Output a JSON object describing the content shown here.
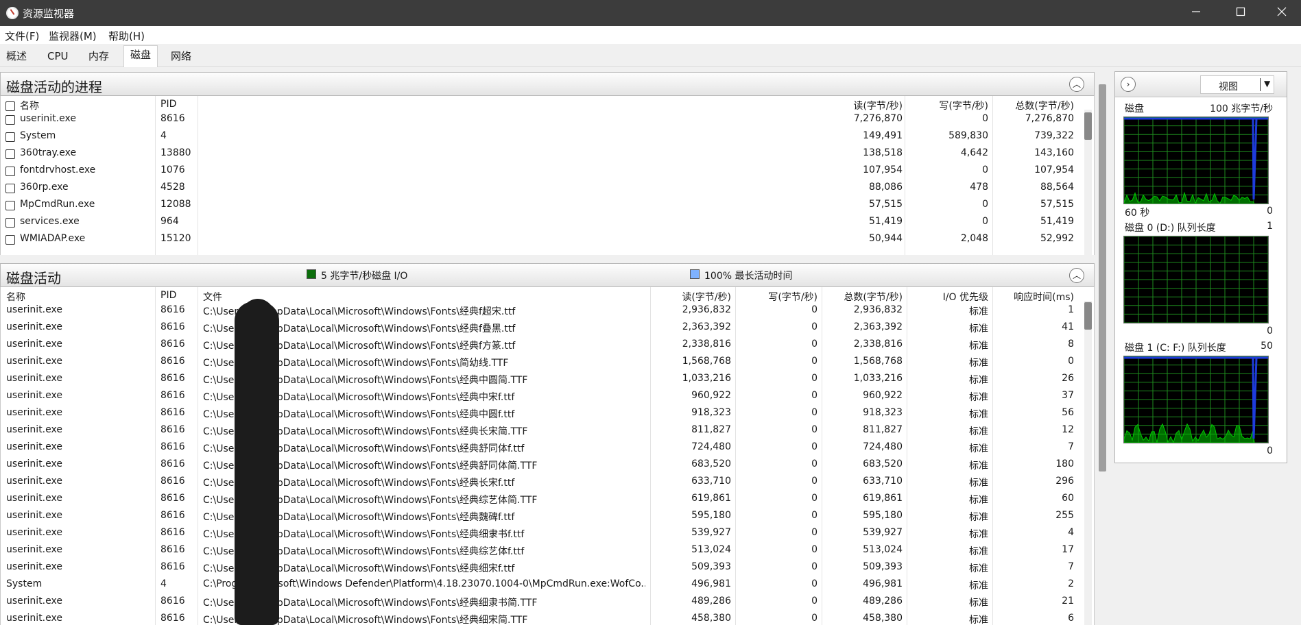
{
  "window": {
    "title": "资源监视器",
    "min_icon": "minimize-icon",
    "max_icon": "maximize-icon",
    "close_icon": "close-icon"
  },
  "menu": [
    "文件(F)",
    "监视器(M)",
    "帮助(H)"
  ],
  "tabs": [
    "概述",
    "CPU",
    "内存",
    "磁盘",
    "网络"
  ],
  "active_tab": "磁盘",
  "processes_panel": {
    "title": "磁盘活动的进程",
    "columns": [
      "名称",
      "PID",
      "读(字节/秒)",
      "写(字节/秒)",
      "总数(字节/秒)"
    ],
    "rows": [
      {
        "name": "userinit.exe",
        "pid": "8616",
        "read": "7,276,870",
        "write": "0",
        "total": "7,276,870"
      },
      {
        "name": "System",
        "pid": "4",
        "read": "149,491",
        "write": "589,830",
        "total": "739,322"
      },
      {
        "name": "360tray.exe",
        "pid": "13880",
        "read": "138,518",
        "write": "4,642",
        "total": "143,160"
      },
      {
        "name": "fontdrvhost.exe",
        "pid": "1076",
        "read": "107,954",
        "write": "0",
        "total": "107,954"
      },
      {
        "name": "360rp.exe",
        "pid": "4528",
        "read": "88,086",
        "write": "478",
        "total": "88,564"
      },
      {
        "name": "MpCmdRun.exe",
        "pid": "12088",
        "read": "57,515",
        "write": "0",
        "total": "57,515"
      },
      {
        "name": "services.exe",
        "pid": "964",
        "read": "51,419",
        "write": "0",
        "total": "51,419"
      },
      {
        "name": "WMIADAP.exe",
        "pid": "15120",
        "read": "50,944",
        "write": "2,048",
        "total": "52,992"
      }
    ]
  },
  "disk_panel": {
    "title": "磁盘活动",
    "legend_io": "5 兆字节/秒磁盘 I/O",
    "legend_active": "100% 最长活动时间",
    "legend_io_color": "#0b6e0b",
    "legend_active_color": "#7fb2ff",
    "columns": [
      "名称",
      "PID",
      "文件",
      "读(字节/秒)",
      "写(字节/秒)",
      "总数(字节/秒)",
      "I/O 优先级",
      "响应时间(ms)"
    ],
    "rows": [
      {
        "name": "userinit.exe",
        "pid": "8616",
        "file": "C:\\Users\\██\\AppData\\Local\\Microsoft\\Windows\\Fonts\\经典f超宋.ttf",
        "read": "2,936,832",
        "write": "0",
        "total": "2,936,832",
        "prio": "标准",
        "resp": "1"
      },
      {
        "name": "userinit.exe",
        "pid": "8616",
        "file": "C:\\Users\\██\\AppData\\Local\\Microsoft\\Windows\\Fonts\\经典f叠黑.ttf",
        "read": "2,363,392",
        "write": "0",
        "total": "2,363,392",
        "prio": "标准",
        "resp": "41"
      },
      {
        "name": "userinit.exe",
        "pid": "8616",
        "file": "C:\\Users\\██\\AppData\\Local\\Microsoft\\Windows\\Fonts\\经典f方篆.ttf",
        "read": "2,338,816",
        "write": "0",
        "total": "2,338,816",
        "prio": "标准",
        "resp": "8"
      },
      {
        "name": "userinit.exe",
        "pid": "8616",
        "file": "C:\\Users\\██\\AppData\\Local\\Microsoft\\Windows\\Fonts\\简幼线.TTF",
        "read": "1,568,768",
        "write": "0",
        "total": "1,568,768",
        "prio": "标准",
        "resp": "0"
      },
      {
        "name": "userinit.exe",
        "pid": "8616",
        "file": "C:\\Users\\██\\AppData\\Local\\Microsoft\\Windows\\Fonts\\经典中圆简.TTF",
        "read": "1,033,216",
        "write": "0",
        "total": "1,033,216",
        "prio": "标准",
        "resp": "26"
      },
      {
        "name": "userinit.exe",
        "pid": "8616",
        "file": "C:\\Users\\██\\AppData\\Local\\Microsoft\\Windows\\Fonts\\经典中宋f.ttf",
        "read": "960,922",
        "write": "0",
        "total": "960,922",
        "prio": "标准",
        "resp": "37"
      },
      {
        "name": "userinit.exe",
        "pid": "8616",
        "file": "C:\\Users\\██\\AppData\\Local\\Microsoft\\Windows\\Fonts\\经典中圆f.ttf",
        "read": "918,323",
        "write": "0",
        "total": "918,323",
        "prio": "标准",
        "resp": "56"
      },
      {
        "name": "userinit.exe",
        "pid": "8616",
        "file": "C:\\Users\\██\\AppData\\Local\\Microsoft\\Windows\\Fonts\\经典长宋简.TTF",
        "read": "811,827",
        "write": "0",
        "total": "811,827",
        "prio": "标准",
        "resp": "12"
      },
      {
        "name": "userinit.exe",
        "pid": "8616",
        "file": "C:\\Users\\██\\AppData\\Local\\Microsoft\\Windows\\Fonts\\经典舒同体f.ttf",
        "read": "724,480",
        "write": "0",
        "total": "724,480",
        "prio": "标准",
        "resp": "7"
      },
      {
        "name": "userinit.exe",
        "pid": "8616",
        "file": "C:\\Users\\██\\AppData\\Local\\Microsoft\\Windows\\Fonts\\经典舒同体简.TTF",
        "read": "683,520",
        "write": "0",
        "total": "683,520",
        "prio": "标准",
        "resp": "180"
      },
      {
        "name": "userinit.exe",
        "pid": "8616",
        "file": "C:\\Users\\██\\AppData\\Local\\Microsoft\\Windows\\Fonts\\经典长宋f.ttf",
        "read": "633,710",
        "write": "0",
        "total": "633,710",
        "prio": "标准",
        "resp": "296"
      },
      {
        "name": "userinit.exe",
        "pid": "8616",
        "file": "C:\\Users\\██\\AppData\\Local\\Microsoft\\Windows\\Fonts\\经典综艺体简.TTF",
        "read": "619,861",
        "write": "0",
        "total": "619,861",
        "prio": "标准",
        "resp": "60"
      },
      {
        "name": "userinit.exe",
        "pid": "8616",
        "file": "C:\\Users\\██\\AppData\\Local\\Microsoft\\Windows\\Fonts\\经典魏碑f.ttf",
        "read": "595,180",
        "write": "0",
        "total": "595,180",
        "prio": "标准",
        "resp": "255"
      },
      {
        "name": "userinit.exe",
        "pid": "8616",
        "file": "C:\\Users\\██\\AppData\\Local\\Microsoft\\Windows\\Fonts\\经典细隶书f.ttf",
        "read": "539,927",
        "write": "0",
        "total": "539,927",
        "prio": "标准",
        "resp": "4"
      },
      {
        "name": "userinit.exe",
        "pid": "8616",
        "file": "C:\\Users\\██\\AppData\\Local\\Microsoft\\Windows\\Fonts\\经典综艺体f.ttf",
        "read": "513,024",
        "write": "0",
        "total": "513,024",
        "prio": "标准",
        "resp": "17"
      },
      {
        "name": "userinit.exe",
        "pid": "8616",
        "file": "C:\\Users\\██\\AppData\\Local\\Microsoft\\Windows\\Fonts\\经典细宋f.ttf",
        "read": "509,393",
        "write": "0",
        "total": "509,393",
        "prio": "标准",
        "resp": "7"
      },
      {
        "name": "System",
        "pid": "4",
        "file": "C:\\Prog██Microsoft\\Windows Defender\\Platform\\4.18.23070.1004-0\\MpCmdRun.exe:WofCo...",
        "read": "496,981",
        "write": "0",
        "total": "496,981",
        "prio": "标准",
        "resp": "2"
      },
      {
        "name": "userinit.exe",
        "pid": "8616",
        "file": "C:\\Users\\██\\AppData\\Local\\Microsoft\\Windows\\Fonts\\经典细隶书简.TTF",
        "read": "489,286",
        "write": "0",
        "total": "489,286",
        "prio": "标准",
        "resp": "21"
      },
      {
        "name": "userinit.exe",
        "pid": "8616",
        "file": "C:\\Users\\██\\AppData\\Local\\Microsoft\\Windows\\Fonts\\经典细宋简.TTF",
        "read": "458,380",
        "write": "0",
        "total": "458,380",
        "prio": "标准",
        "resp": "6"
      }
    ]
  },
  "right_panel": {
    "nav_icon": "chevron-right-icon",
    "view_label": "视图",
    "graphs": [
      {
        "title": "磁盘",
        "scale_max": "100 兆字节/秒",
        "footer_left": "60 秒",
        "footer_right": "0"
      },
      {
        "title": "磁盘 0 (D:) 队列长度",
        "scale_max": "1",
        "footer_left": "",
        "footer_right": "0"
      },
      {
        "title": "磁盘 1 (C: F:) 队列长度",
        "scale_max": "50",
        "footer_left": "",
        "footer_right": "0"
      }
    ],
    "grid_color": "#1e8c1e",
    "activity_color": "#00c800",
    "highlight_color": "#1e3cdc"
  }
}
